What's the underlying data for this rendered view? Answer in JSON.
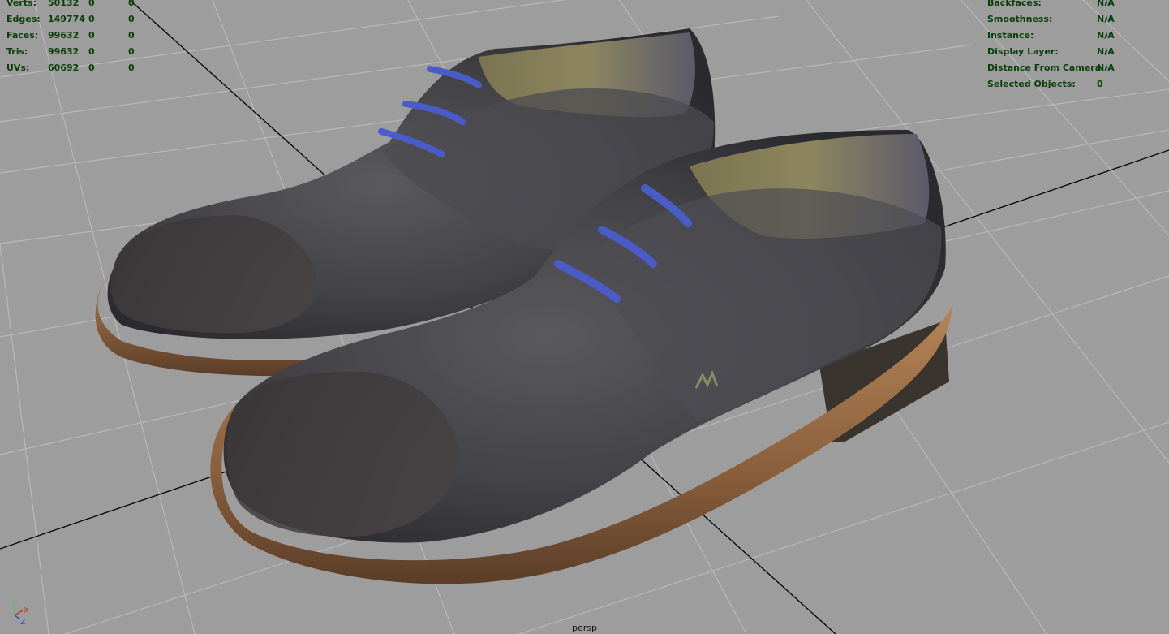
{
  "stats": {
    "rows": [
      {
        "label": "Verts:",
        "values": [
          "50132",
          "0",
          "0"
        ]
      },
      {
        "label": "Edges:",
        "values": [
          "149774",
          "0",
          "0"
        ]
      },
      {
        "label": "Faces:",
        "values": [
          "99632",
          "0",
          "0"
        ]
      },
      {
        "label": "Tris:",
        "values": [
          "99632",
          "0",
          "0"
        ]
      },
      {
        "label": "UVs:",
        "values": [
          "60692",
          "0",
          "0"
        ]
      }
    ]
  },
  "display_info": {
    "rows": [
      {
        "label": "Backfaces:",
        "value": "N/A"
      },
      {
        "label": "Smoothness:",
        "value": "N/A"
      },
      {
        "label": "Instance:",
        "value": "N/A"
      },
      {
        "label": "Display Layer:",
        "value": "N/A"
      },
      {
        "label": "Distance From Camera:",
        "value": "N/A"
      },
      {
        "label": "Selected Objects:",
        "value": "0"
      }
    ]
  },
  "camera": {
    "name": "persp"
  },
  "axis": {
    "y": "Y",
    "x": "X",
    "z": "Z",
    "colors": {
      "y": "#2fd02f",
      "x": "#d02f2f",
      "z": "#2f4fd0"
    }
  },
  "viewport": {
    "background": "#9d9d9d",
    "grid_color": "#b8b8b8",
    "axis_line_color": "#000000"
  }
}
